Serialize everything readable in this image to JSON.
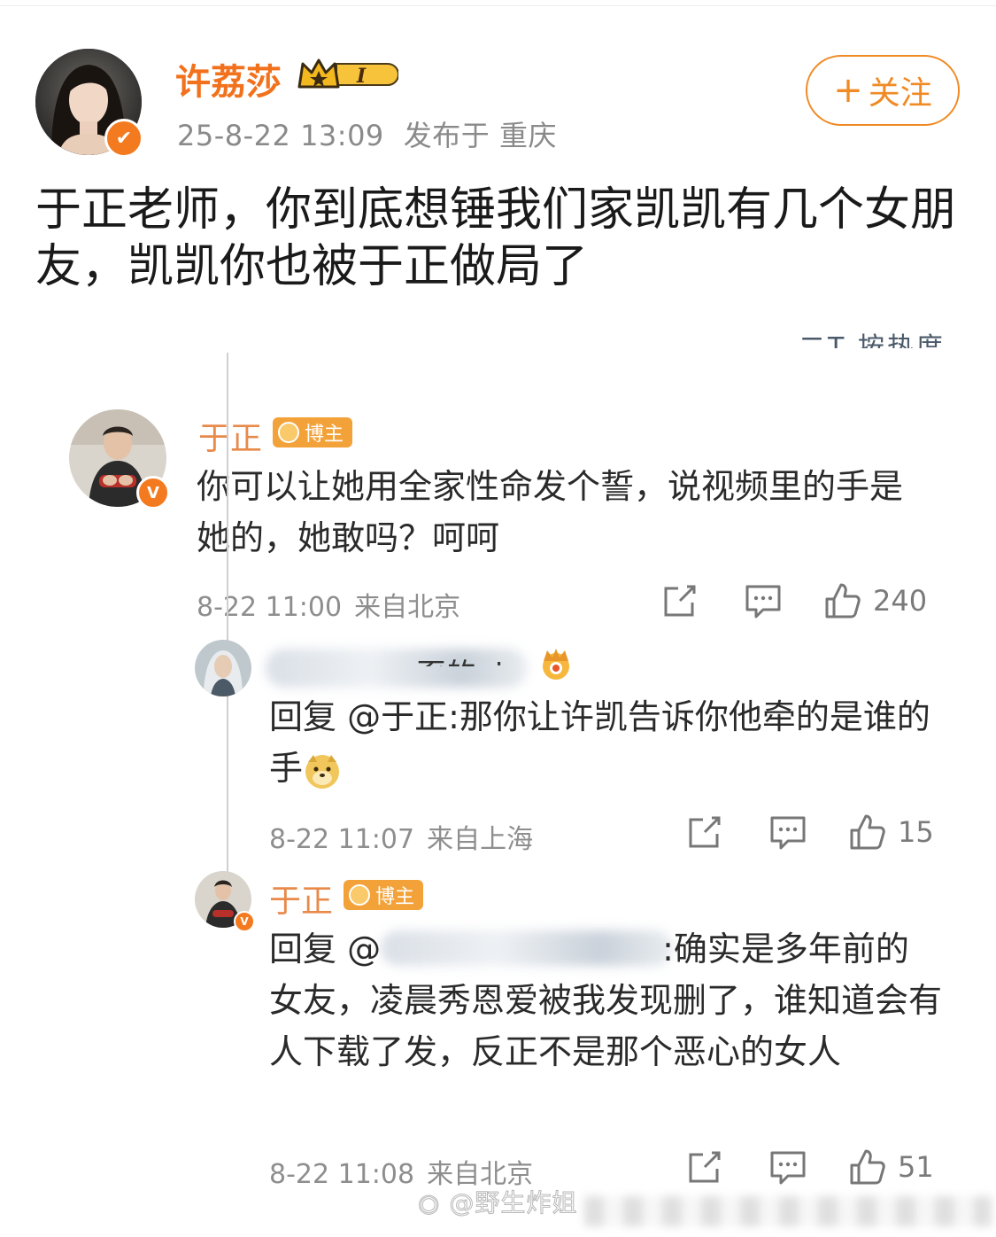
{
  "post": {
    "author_name": "许荔莎",
    "level_badge": "I",
    "date": "25-8-22 13:09",
    "location": "发布于 重庆",
    "follow_label": "关注",
    "text": "于正老师，你到底想锤我们家凯凯有几个女朋友，凯凯你也被于正做局了"
  },
  "screenshot": {
    "sort_label": "二T 按热度",
    "comments": [
      {
        "name": "于正",
        "badge": "博主",
        "text": "你可以让她用全家性命发个誓，说视频里的手是她的，她敢吗？呵呵",
        "time": "8-22 11:00",
        "location": "来自北京",
        "likes": "240"
      }
    ],
    "replies": [
      {
        "name_visible": "豕的ai",
        "reply_prefix": "回复 ",
        "mention": "@于正",
        "text": ":那你让许凯告诉你他牵的是谁的手",
        "time": "8-22 11:07",
        "location": "来自上海",
        "likes": "15"
      },
      {
        "name": "于正",
        "badge": "博主",
        "reply_prefix": "回复 ",
        "mention": "@",
        "text": ":确实是多年前的女友，凌晨秀恩爱被我发现删了，谁知道会有人下载了发，反正不是那个恶心的女人",
        "time": "8-22 11:08",
        "location": "来自北京",
        "likes": "51"
      }
    ],
    "watermark": "@野生炸姐"
  },
  "colors": {
    "brand_orange": "#f2711c",
    "verified": "#f47a1f",
    "meta_gray": "#8a8a8a"
  },
  "icons": [
    "verified-badge-icon",
    "crown-icon",
    "share-icon",
    "comment-icon",
    "like-icon",
    "doge-emoji-icon",
    "weibo-logo-icon"
  ]
}
